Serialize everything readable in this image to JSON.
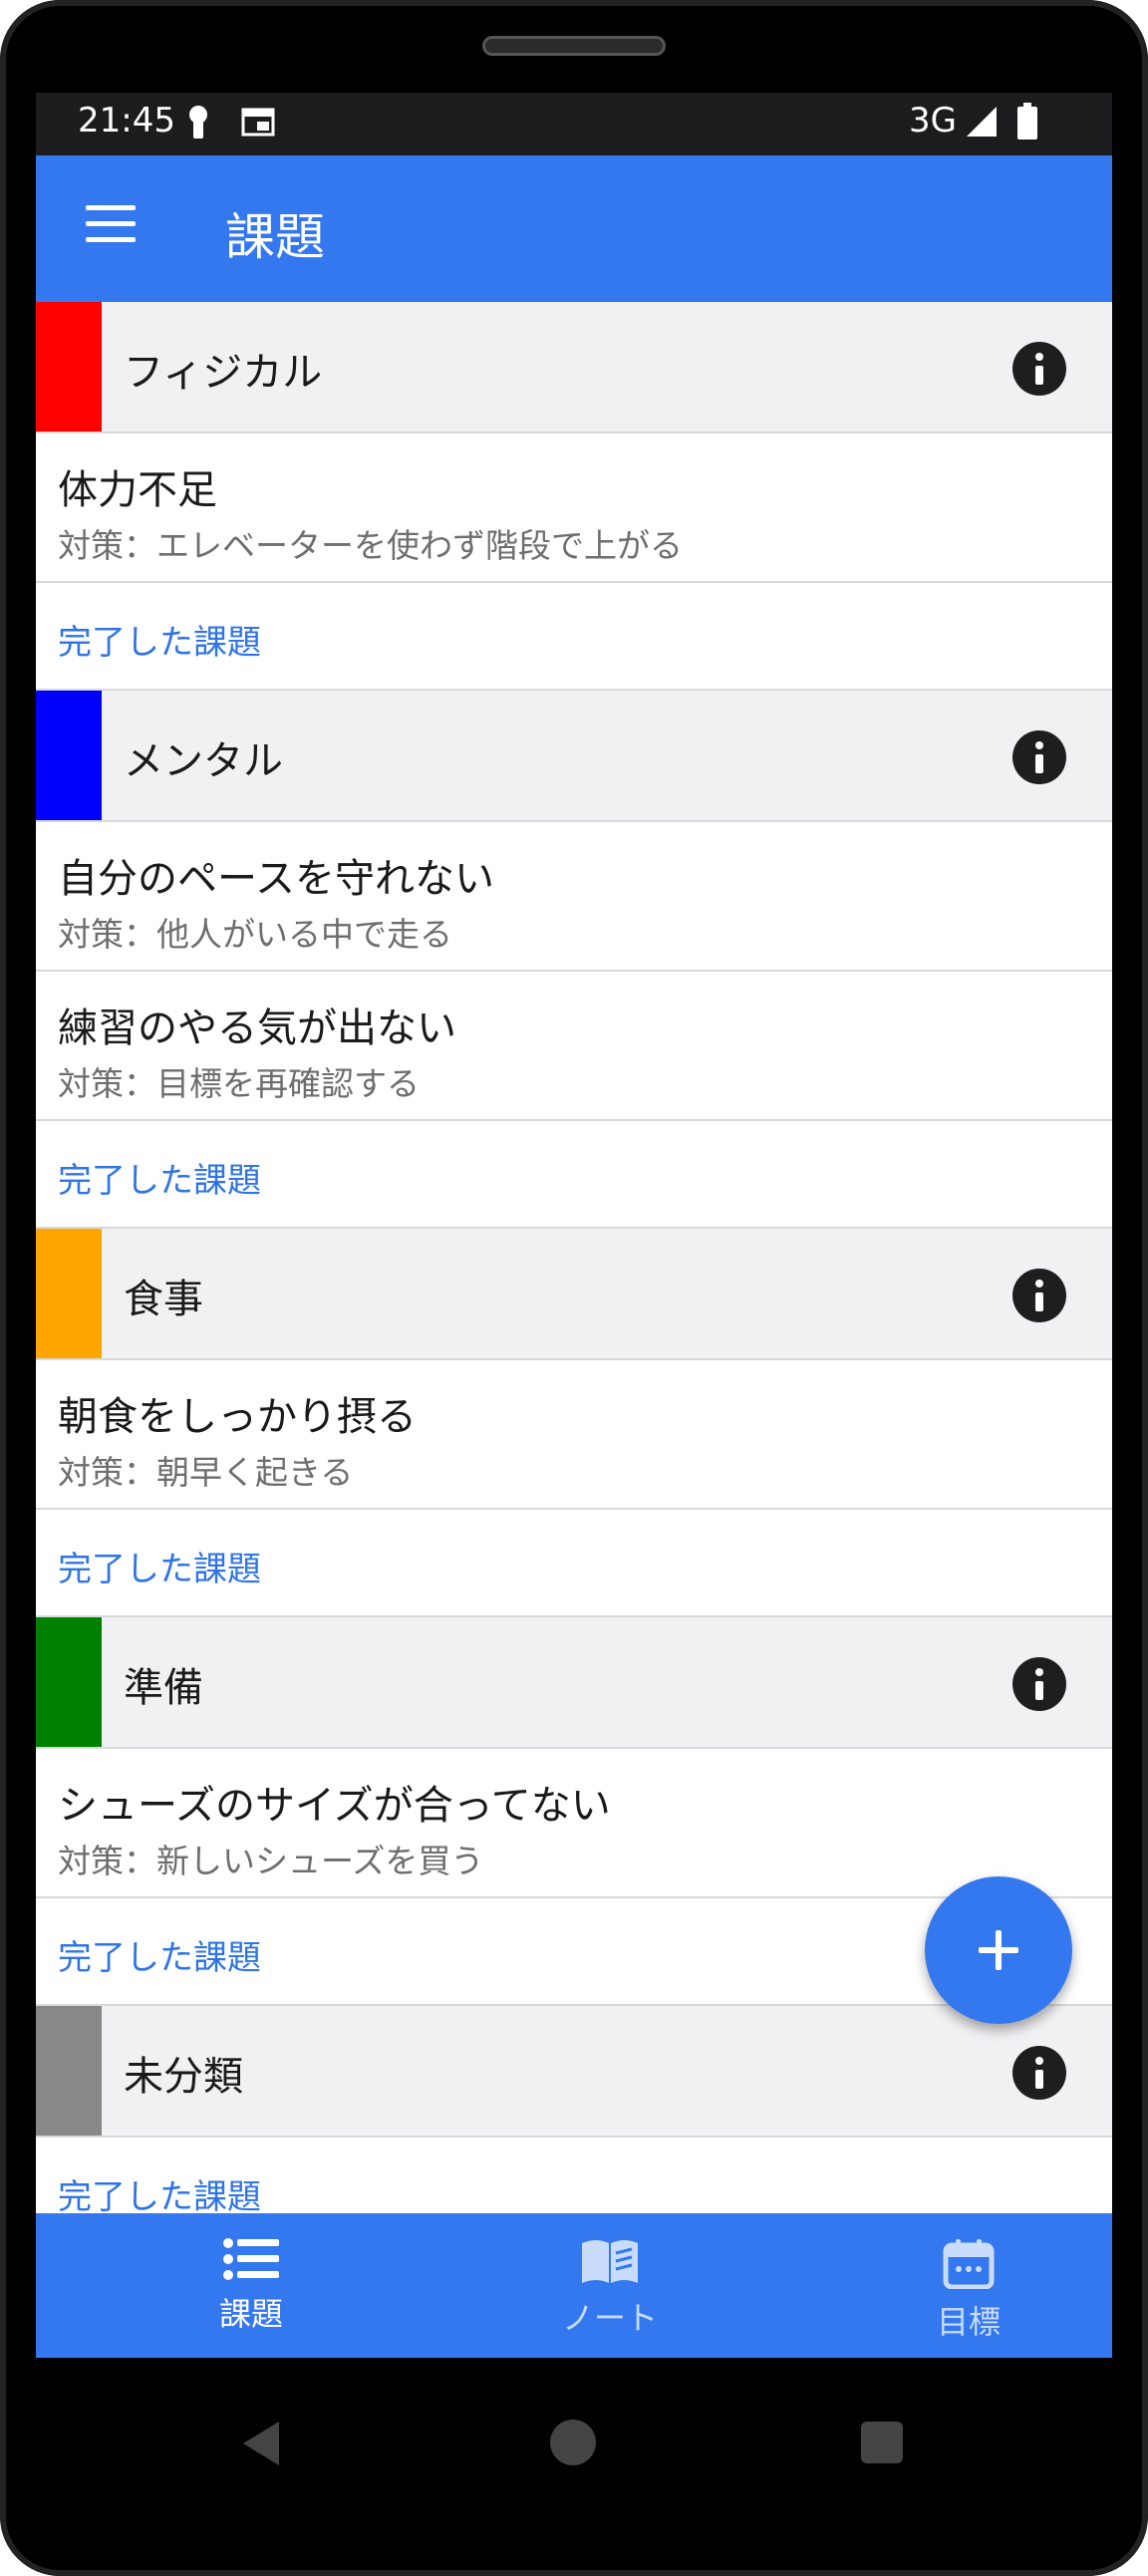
{
  "status_bar": {
    "time": "21:45",
    "network": "3G"
  },
  "app_bar": {
    "title": "課題"
  },
  "groups": [
    {
      "title": "フィジカル",
      "color": "#ff0000",
      "tasks": [
        {
          "title": "体力不足",
          "measure": "対策：エレベーターを使わず階段で上がる"
        }
      ],
      "done_label": "完了した課題"
    },
    {
      "title": "メンタル",
      "color": "#0000ff",
      "tasks": [
        {
          "title": "自分のペースを守れない",
          "measure": "対策：他人がいる中で走る"
        },
        {
          "title": "練習のやる気が出ない",
          "measure": "対策：目標を再確認する"
        }
      ],
      "done_label": "完了した課題"
    },
    {
      "title": "食事",
      "color": "#ffa500",
      "tasks": [
        {
          "title": "朝食をしっかり摂る",
          "measure": "対策：朝早く起きる"
        }
      ],
      "done_label": "完了した課題"
    },
    {
      "title": "準備",
      "color": "#008000",
      "tasks": [
        {
          "title": "シューズのサイズが合ってない",
          "measure": "対策：新しいシューズを買う"
        }
      ],
      "done_label": "完了した課題"
    },
    {
      "title": "未分類",
      "color": "#888888",
      "tasks": [],
      "done_label": "完了した課題"
    }
  ],
  "bottom_nav": [
    {
      "label": "課題",
      "icon": "list-icon",
      "active": true
    },
    {
      "label": "ノート",
      "icon": "book-icon",
      "active": false
    },
    {
      "label": "目標",
      "icon": "calendar-icon",
      "active": false
    }
  ],
  "colors": {
    "primary": "#3478f0",
    "link": "#2f74e6"
  }
}
